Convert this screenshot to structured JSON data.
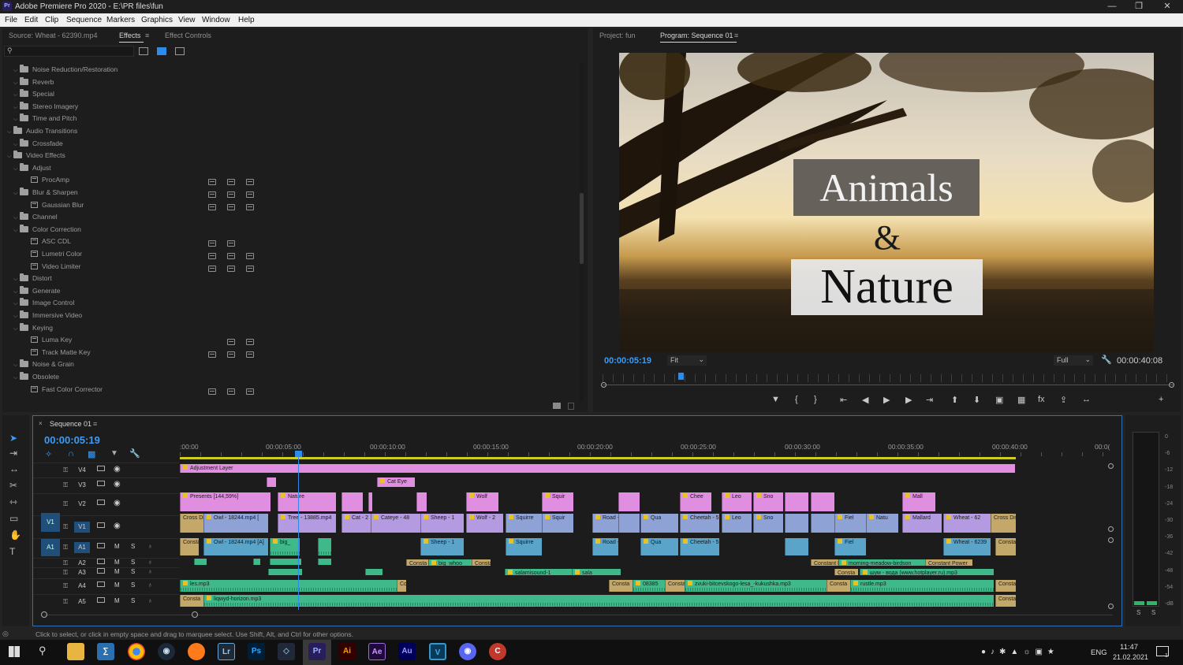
{
  "window": {
    "title": "Adobe Premiere Pro 2020 - E:\\PR files\\fun",
    "app_icon": "Pr"
  },
  "menu": [
    "File",
    "Edit",
    "Clip",
    "Sequence",
    "Markers",
    "Graphics",
    "View",
    "Window",
    "Help"
  ],
  "left_panel": {
    "tabs": [
      "Source: Wheat - 62390.mp4",
      "Effects",
      "Effect Controls"
    ],
    "active_tab": "Effects",
    "tree": [
      {
        "label": "Noise Reduction/Restoration",
        "level": 1,
        "type": "folder"
      },
      {
        "label": "Reverb",
        "level": 1,
        "type": "folder"
      },
      {
        "label": "Special",
        "level": 1,
        "type": "folder"
      },
      {
        "label": "Stereo Imagery",
        "level": 1,
        "type": "folder"
      },
      {
        "label": "Time and Pitch",
        "level": 1,
        "type": "folder"
      },
      {
        "label": "Audio Transitions",
        "level": 0,
        "type": "folder"
      },
      {
        "label": "Crossfade",
        "level": 1,
        "type": "folder"
      },
      {
        "label": "Video Effects",
        "level": 0,
        "type": "folder"
      },
      {
        "label": "Adjust",
        "level": 1,
        "type": "folder"
      },
      {
        "label": "ProcAmp",
        "level": 2,
        "type": "effect",
        "badges": 3
      },
      {
        "label": "Blur & Sharpen",
        "level": 1,
        "type": "folder",
        "badges": 3
      },
      {
        "label": "Gaussian Blur",
        "level": 2,
        "type": "effect",
        "badges": 3
      },
      {
        "label": "Channel",
        "level": 1,
        "type": "folder"
      },
      {
        "label": "Color Correction",
        "level": 1,
        "type": "folder"
      },
      {
        "label": "ASC CDL",
        "level": 2,
        "type": "effect",
        "badges": 2
      },
      {
        "label": "Lumetri Color",
        "level": 2,
        "type": "effect",
        "badges": 3
      },
      {
        "label": "Video Limiter",
        "level": 2,
        "type": "effect",
        "badges": 3
      },
      {
        "label": "Distort",
        "level": 1,
        "type": "folder"
      },
      {
        "label": "Generate",
        "level": 1,
        "type": "folder"
      },
      {
        "label": "Image Control",
        "level": 1,
        "type": "folder"
      },
      {
        "label": "Immersive Video",
        "level": 1,
        "type": "folder"
      },
      {
        "label": "Keying",
        "level": 1,
        "type": "folder"
      },
      {
        "label": "Luma Key",
        "level": 2,
        "type": "effect",
        "badges": 2,
        "offset": 1
      },
      {
        "label": "Track Matte Key",
        "level": 2,
        "type": "effect",
        "badges": 3
      },
      {
        "label": "Noise & Grain",
        "level": 1,
        "type": "folder"
      },
      {
        "label": "Obsolete",
        "level": 1,
        "type": "folder"
      },
      {
        "label": "Fast Color Corrector",
        "level": 2,
        "type": "effect",
        "badges": 3
      }
    ]
  },
  "program": {
    "tabs": [
      "Project: fun",
      "Program: Sequence 01"
    ],
    "active_tab": "Program: Sequence 01",
    "title_lines": [
      "Animals",
      "&",
      "Nature"
    ],
    "timecode": "00:00:05:19",
    "fit": "Fit",
    "quality": "Full",
    "duration": "00:00:40:08"
  },
  "timeline": {
    "sequence": "Sequence 01",
    "timecode": "00:00:05:19",
    "ruler": [
      ":00:00",
      "00:00:05:00",
      "00:00:10:00",
      "00:00:15:00",
      "00:00:20:00",
      "00:00:25:00",
      "00:00:30:00",
      "00:00:35:00",
      "00:00:40:00",
      "00:0("
    ],
    "tracks": [
      "V4",
      "V3",
      "V2",
      "V1",
      "A1",
      "A2",
      "A3",
      "A4",
      "A5"
    ],
    "source_patch": [
      "V1",
      "A1"
    ],
    "track_btn": {
      "mute": "M",
      "solo": "S"
    },
    "meter_ticks": [
      "0",
      "-6",
      "-12",
      "-18",
      "-24",
      "-30",
      "-36",
      "-42",
      "-48",
      "-54",
      "-dB"
    ],
    "meter_solo": [
      "S",
      "S"
    ],
    "clip_labels": {
      "adj": "Adjustment Layer",
      "cateye": "Cat Eye",
      "presents": "Presents [144,59%]",
      "nature": "Nature",
      "wolf": "Wolf",
      "squir": "Squir",
      "chee": "Chee",
      "leo": "Leo",
      "sno": "Sno",
      "mall": "Mall",
      "crossdis": "Cross Dis",
      "owl": "Owl - 18244.mp4 [",
      "tree": "Tree - 13885.mp4",
      "cat2": "Cat - 2",
      "cateye48": "Cateye - 48",
      "sheep1": "Sheep - 1",
      "wolf2": "Wolf - 2",
      "squirre": "Squirre",
      "road5": "Road - 5",
      "qua": "Qua",
      "cheetah5": "Cheetah - 5",
      "fiel": "Fiel",
      "natu": "Natu",
      "mallard": "Mallard",
      "wheat62": "Wheat - 62",
      "crossdis2": "Cross Dis",
      "consta": "Consta",
      "owl_a": "Owl - 18244.mp4 [A]",
      "big": "big_",
      "wheat6239": "Wheat - 6239",
      "big_whoo": "big_whoo",
      "morning": "morning-meadow-birdson",
      "salamisound": "salamisound-1",
      "sala": "sala",
      "shum": "шум - вода (www.hotplayer.ru).mp3",
      "constpower": "Constant Power",
      "les": "les.mp3",
      "co": "Co",
      "n08385": "08385",
      "zvuki": "zvuki-bitcevskogo-lesa_-kukushka.mp3",
      "rustle": "rustle.mp3",
      "liqwyd": "liqwyd-horizon.mp3"
    }
  },
  "status_bar": "Click to select, or click in empty space and drag to marquee select. Use Shift, Alt, and Ctrl for other options.",
  "taskbar": {
    "lang": "ENG",
    "time": "11:47",
    "date": "21.02.2021",
    "notif_count": "1"
  },
  "colors": {
    "accent_blue": "#2d8ceb",
    "timecode": "#3d9cf5",
    "video_clip": "#e08ee0",
    "audio_clip": "#3fb98a"
  }
}
